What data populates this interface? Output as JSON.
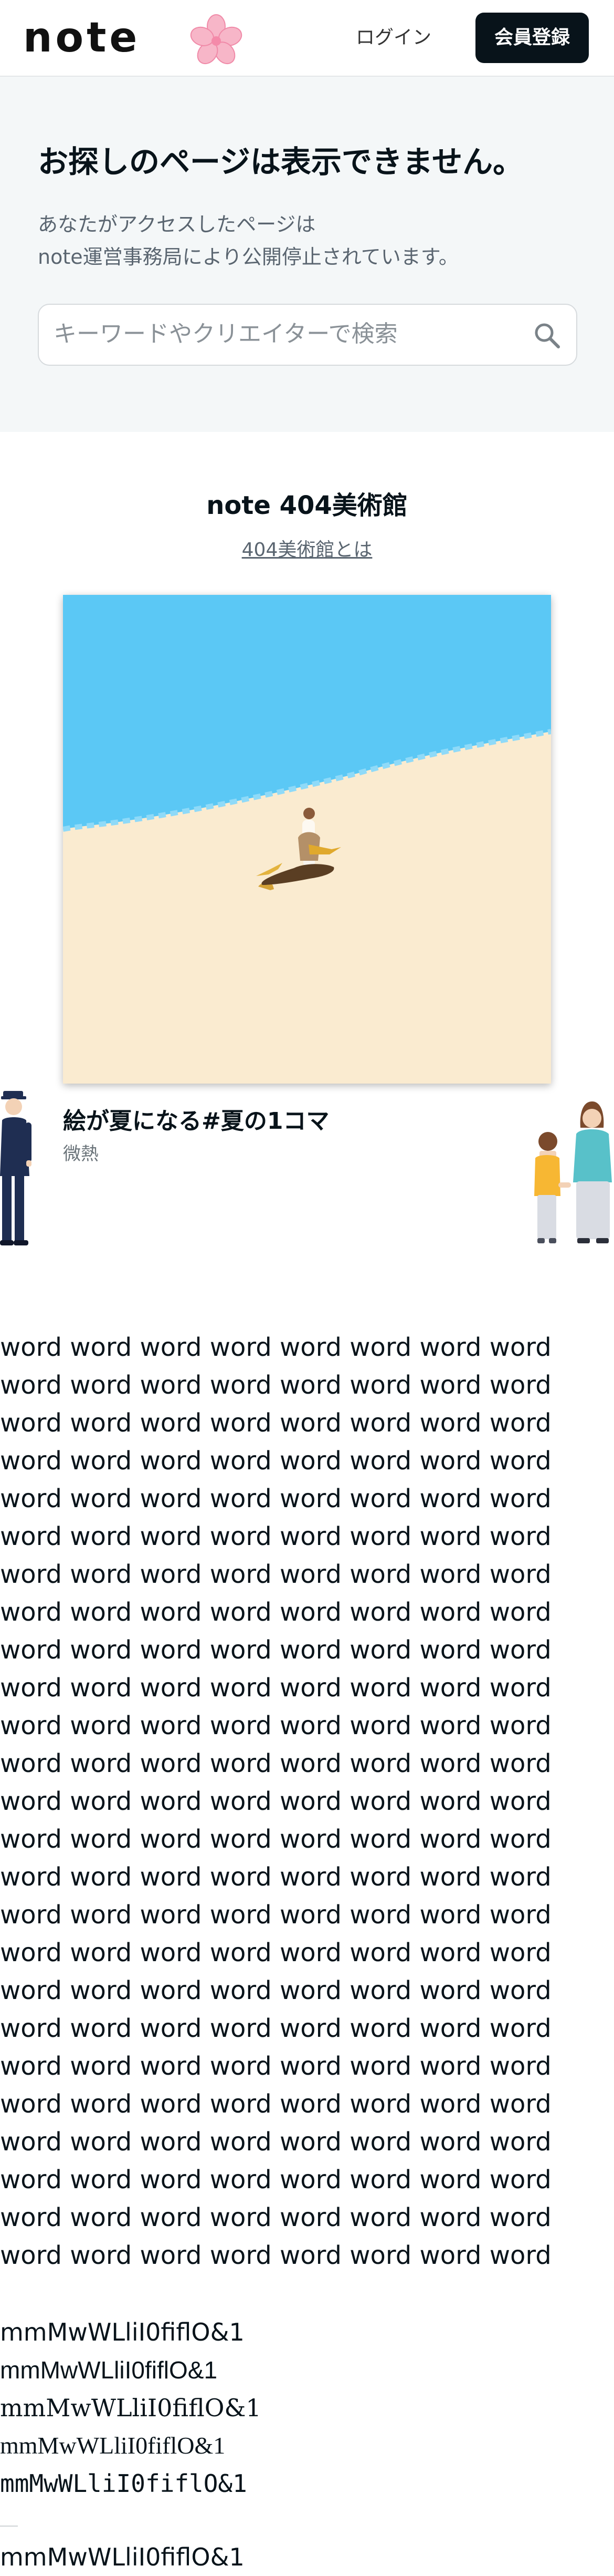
{
  "header": {
    "logo_text": "note",
    "logo_icon": "cherry-blossom-icon",
    "login_label": "ログイン",
    "signup_label": "会員登録"
  },
  "error": {
    "title": "お探しのページは表示できません。",
    "desc_line1": "あなたがアクセスしたページは",
    "desc_line2": "note運営事務局により公開停止されています。",
    "search_placeholder": "キーワードやクリエイターで検索"
  },
  "museum": {
    "title": "note 404美術館",
    "about_link": "404美術館とは",
    "artwork_title": "絵が夏になる#夏の1コマ",
    "artwork_author": "微熱"
  },
  "filler": {
    "word_lines": [
      "word word word word word word word word",
      "word word word word word word word word",
      "word word word word word word word word",
      "word word word word word word word word",
      "word word word word word word word word",
      "word word word word word word word word",
      "word word word word word word word word",
      "word word word word word word word word",
      "word word word word word word word word",
      "word word word word word word word word",
      "word word word word word word word word",
      "word word word word word word word word",
      "word word word word word word word word",
      "word word word word word word word word",
      "word word word word word word word word",
      "word word word word word word word word",
      "word word word word word word word word",
      "word word word word word word word word",
      "word word word word word word word word",
      "word word word word word word word word",
      "word word word word word word word word",
      "word word word word word word word word",
      "word word word word word word word word",
      "word word word word word word word word",
      "word word word word word word word word"
    ],
    "glyph_lines": [
      "mmMwWLliI0fiflO&1",
      "mmMwWLliI0fiflO&1",
      "mmMwWLliI0fiflO&1",
      "mmMwWLliI0fiflO&1",
      "mmMwWLliI0fiflO&1",
      "mmMwWLliI0fiflO&1"
    ]
  },
  "colors": {
    "sky": "#5bc8f5",
    "sand": "#faebd0",
    "signup_bg": "#08131a",
    "error_bg": "#f4f7f8"
  }
}
